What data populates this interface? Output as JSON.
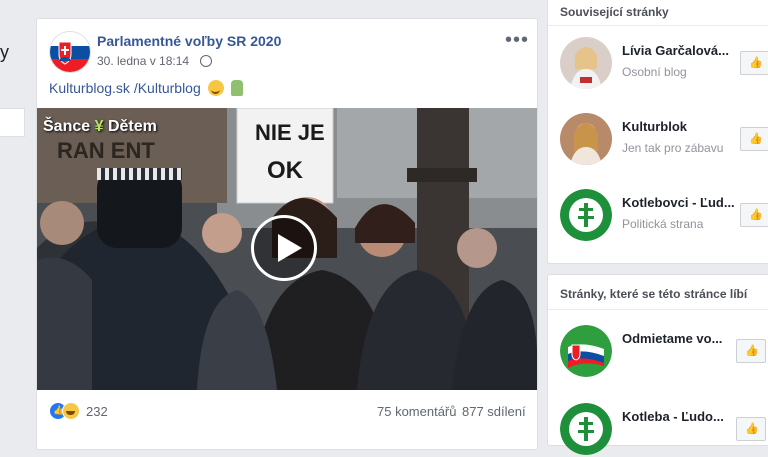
{
  "left": {
    "fragment": "y"
  },
  "post": {
    "page_name": "Parlamentné voľby SR 2020",
    "date": "30. ledna v 18:14",
    "text_link": "Kulturblog.sk /Kulturblog",
    "video": {
      "watermark_a": "Šance",
      "watermark_b": "Dětem",
      "sign_text_1": "NIE JE",
      "sign_text_2": "OK",
      "sign_text_bg": "RAN  ENT"
    },
    "reactions_count": "232",
    "comments": "75 komentářů",
    "shares": "877 sdílení"
  },
  "sidebar": {
    "related_title": "Související stránky",
    "related": [
      {
        "name": "Lívia Garčalová...",
        "category": "Osobní blog"
      },
      {
        "name": "Kulturblok",
        "category": "Jen tak pro zábavu"
      },
      {
        "name": "Kotlebovci - Ľud...",
        "category": "Politická strana"
      }
    ],
    "liked_title": "Stránky, které se této stránce líbí",
    "liked": [
      {
        "name": "Odmietame vo..."
      },
      {
        "name": "Kotleba - Ľudo..."
      }
    ]
  },
  "colors": {
    "link": "#365899",
    "like_blue": "#2078f4",
    "page_bg": "#e9ebee"
  }
}
